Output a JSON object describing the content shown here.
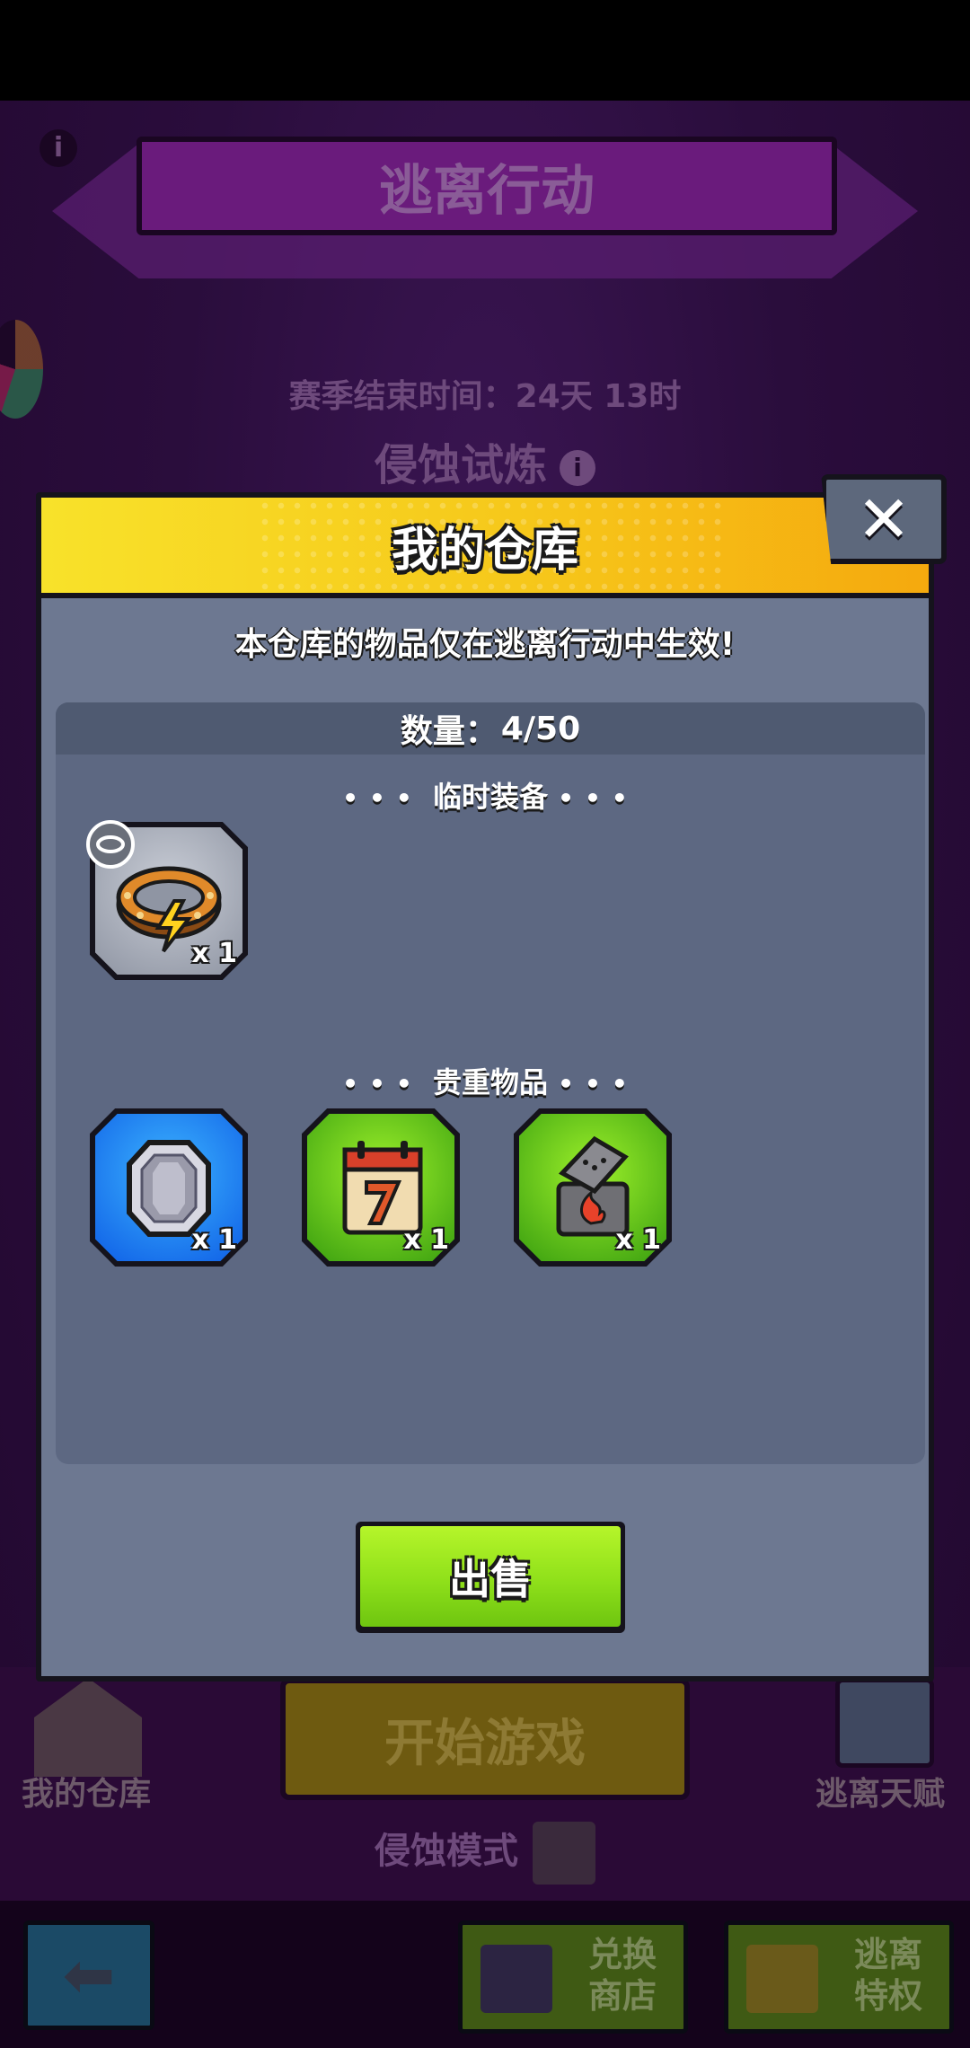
{
  "background": {
    "event_title": "逃离行动",
    "season_end": "赛季结束时间：24天 13时",
    "mode_title": "侵蚀试炼",
    "storage_button": "我的仓库",
    "start_button": "开始游戏",
    "talent_button": "逃离天赋",
    "corrode_mode": "侵蚀模式",
    "shop_button": "兑换\n商店",
    "privilege_button": "逃离\n特权",
    "info_icon_glyph": "i",
    "back_glyph": "⬅"
  },
  "modal": {
    "title": "我的仓库",
    "close_glyph": "✕",
    "subtitle": "本仓库的物品仅在逃离行动中生效!",
    "count_label": "数量：",
    "count_value": "4/50",
    "dots": "•••",
    "sections": [
      {
        "label": "临时装备",
        "items": [
          {
            "icon": "collar-icon",
            "rarity": "grey",
            "qty": "x 1"
          }
        ]
      },
      {
        "label": "贵重物品",
        "items": [
          {
            "icon": "gem-icon",
            "rarity": "blue",
            "qty": "x 1"
          },
          {
            "icon": "calendar-icon",
            "rarity": "green",
            "qty": "x 1"
          },
          {
            "icon": "lighter-icon",
            "rarity": "green",
            "qty": "x 1"
          }
        ]
      }
    ],
    "sell_button": "出售"
  },
  "colors": {
    "header_yellow": "#f8e22a",
    "panel_grey": "#6d7891",
    "sell_green": "#8fe01a",
    "rarity_blue": "#1e7ef5",
    "rarity_green": "#5bc417"
  }
}
